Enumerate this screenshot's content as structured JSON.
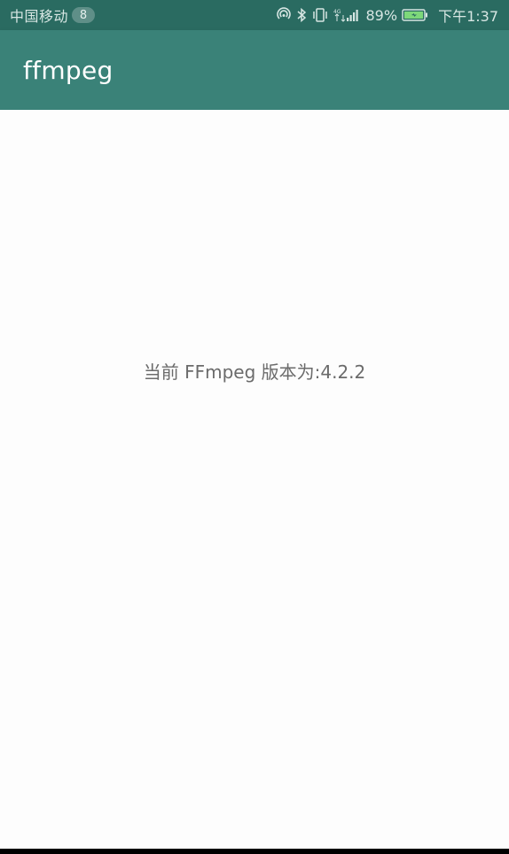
{
  "status_bar": {
    "carrier": "中国移动",
    "notification_count": "8",
    "network_label": "4G",
    "battery_percent": "89%",
    "time": "下午1:37",
    "icons": [
      "hotspot-icon",
      "bluetooth-icon",
      "vibrate-icon",
      "signal-icon",
      "battery-icon"
    ]
  },
  "app_bar": {
    "title": "ffmpeg"
  },
  "main": {
    "version_text": "当前 FFmpeg 版本为:4.2.2"
  },
  "colors": {
    "status_bar": "#2a6b61",
    "app_bar": "#3a8278",
    "background": "#fdfdfd",
    "body_text": "#6b6b6b"
  }
}
